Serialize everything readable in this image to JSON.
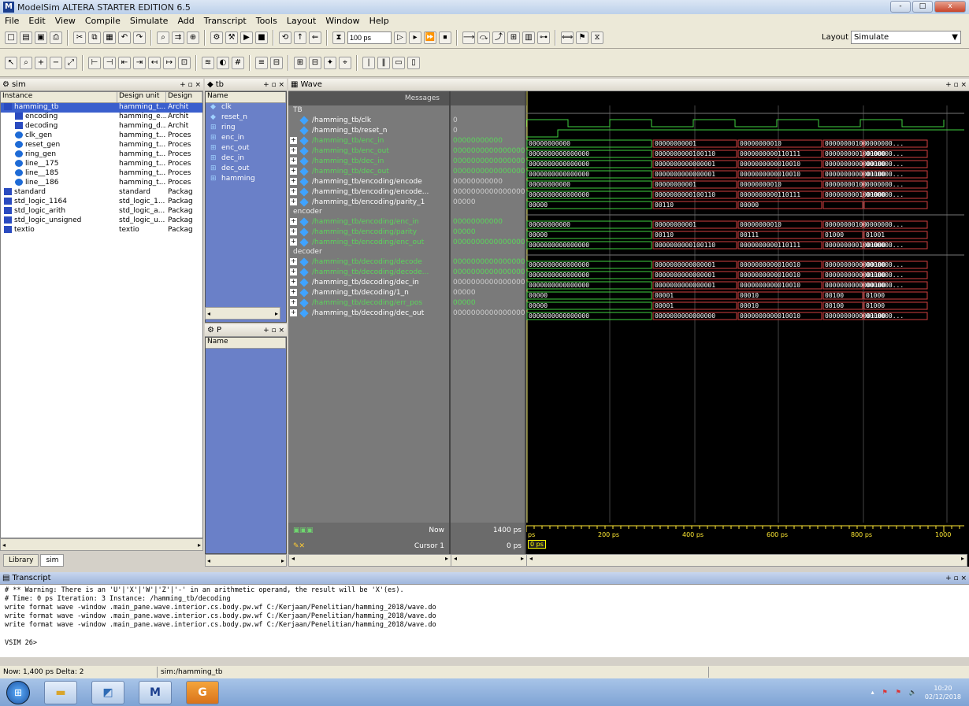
{
  "title": "ModelSim ALTERA STARTER EDITION 6.5",
  "window_controls": [
    "-",
    "□",
    "x"
  ],
  "menu": [
    "File",
    "Edit",
    "View",
    "Compile",
    "Simulate",
    "Add",
    "Transcript",
    "Tools",
    "Layout",
    "Window",
    "Help"
  ],
  "toolbar": {
    "sim_time": "100 ps",
    "layout_label": "Layout",
    "layout_value": "Simulate"
  },
  "sim_panel": {
    "title": "sim",
    "columns": [
      "Instance",
      "Design unit",
      "Design"
    ],
    "rows": [
      {
        "name": "hamming_tb",
        "unit": "hamming_t...",
        "type": "Archit",
        "icon": "box",
        "indent": 0,
        "selected": true
      },
      {
        "name": "encoding",
        "unit": "hamming_e...",
        "type": "Archit",
        "icon": "box",
        "indent": 1
      },
      {
        "name": "decoding",
        "unit": "hamming_d...",
        "type": "Archit",
        "icon": "box",
        "indent": 1
      },
      {
        "name": "clk_gen",
        "unit": "hamming_t...",
        "type": "Proces",
        "icon": "proc",
        "indent": 1
      },
      {
        "name": "reset_gen",
        "unit": "hamming_t...",
        "type": "Proces",
        "icon": "proc",
        "indent": 1
      },
      {
        "name": "ring_gen",
        "unit": "hamming_t...",
        "type": "Proces",
        "icon": "proc",
        "indent": 1
      },
      {
        "name": "line__175",
        "unit": "hamming_t...",
        "type": "Proces",
        "icon": "proc",
        "indent": 1
      },
      {
        "name": "line__185",
        "unit": "hamming_t...",
        "type": "Proces",
        "icon": "proc",
        "indent": 1
      },
      {
        "name": "line__186",
        "unit": "hamming_t...",
        "type": "Proces",
        "icon": "proc",
        "indent": 1
      },
      {
        "name": "standard",
        "unit": "standard",
        "type": "Packag",
        "icon": "box",
        "indent": 0
      },
      {
        "name": "std_logic_1164",
        "unit": "std_logic_1...",
        "type": "Packag",
        "icon": "box",
        "indent": 0
      },
      {
        "name": "std_logic_arith",
        "unit": "std_logic_a...",
        "type": "Packag",
        "icon": "box",
        "indent": 0
      },
      {
        "name": "std_logic_unsigned",
        "unit": "std_logic_u...",
        "type": "Packag",
        "icon": "box",
        "indent": 0
      },
      {
        "name": "textio",
        "unit": "textio",
        "type": "Packag",
        "icon": "box",
        "indent": 0
      }
    ],
    "tabs": [
      "Library",
      "sim"
    ]
  },
  "objects_panel": {
    "title": "tb",
    "column": "Name",
    "items": [
      "clk",
      "reset_n",
      "ring",
      "enc_in",
      "enc_out",
      "dec_in",
      "dec_out",
      "hamming"
    ]
  },
  "processes_panel": {
    "title": "P",
    "column": "Name"
  },
  "wave_panel": {
    "title": "Wave",
    "messages_label": "Messages",
    "groups": [
      {
        "label": "TB",
        "signals": [
          {
            "name": "/hamming_tb/clk",
            "value": "0",
            "green": false,
            "expand": false,
            "kind": "clk"
          },
          {
            "name": "/hamming_tb/reset_n",
            "value": "0",
            "green": false,
            "expand": false,
            "kind": "reset"
          },
          {
            "name": "/hamming_tb/enc_in",
            "value": "00000000000",
            "green": true,
            "expand": true,
            "kind": "bus",
            "segs": [
              "00000000000",
              "00000000001",
              "00000000010",
              "00000000100",
              "0000000..."
            ]
          },
          {
            "name": "/hamming_tb/enc_out",
            "value": "0000000000000000",
            "green": true,
            "expand": true,
            "kind": "bus",
            "segs": [
              "0000000000000000",
              "0000000000100110",
              "0000000000110111",
              "0000000001001000",
              "0000000..."
            ]
          },
          {
            "name": "/hamming_tb/dec_in",
            "value": "0000000000000000",
            "green": true,
            "expand": true,
            "kind": "bus",
            "segs": [
              "0000000000000000",
              "0000000000000001",
              "0000000000010010",
              "0000000000000100",
              "0000000..."
            ]
          },
          {
            "name": "/hamming_tb/dec_out",
            "value": "0000000000000000",
            "green": true,
            "expand": true,
            "kind": "bus",
            "segs": [
              "0000000000000000",
              "0000000000000001",
              "0000000000010010",
              "0000000000001100",
              "0000000..."
            ]
          },
          {
            "name": "/hamming_tb/encoding/encode",
            "value": "00000000000",
            "green": false,
            "expand": true,
            "kind": "bus",
            "segs": [
              "00000000000",
              "00000000001",
              "00000000010",
              "00000000100",
              "0000000..."
            ]
          },
          {
            "name": "/hamming_tb/encoding/encode...",
            "value": "0000000000000000",
            "green": false,
            "expand": true,
            "kind": "bus",
            "segs": [
              "0000000000000000",
              "0000000000100110",
              "0000000000110111",
              "0000000001001000",
              "0000000..."
            ]
          },
          {
            "name": "/hamming_tb/encoding/parity_1",
            "value": "00000",
            "green": false,
            "expand": true,
            "kind": "bus",
            "segs": [
              "00000",
              "00110",
              "00000",
              "",
              ""
            ]
          }
        ]
      },
      {
        "label": "encoder",
        "signals": [
          {
            "name": "/hamming_tb/encoding/enc_in",
            "value": "00000000000",
            "green": true,
            "expand": true,
            "kind": "bus",
            "segs": [
              "00000000000",
              "00000000001",
              "00000000010",
              "00000000100",
              "0000000..."
            ]
          },
          {
            "name": "/hamming_tb/encoding/parity",
            "value": "00000",
            "green": true,
            "expand": true,
            "kind": "bus",
            "segs": [
              "00000",
              "00110",
              "00111",
              "01000",
              "01001"
            ]
          },
          {
            "name": "/hamming_tb/encoding/enc_out",
            "value": "0000000000000000",
            "green": true,
            "expand": true,
            "kind": "bus",
            "segs": [
              "0000000000000000",
              "0000000000100110",
              "0000000000110111",
              "0000000001001000",
              "0000000..."
            ]
          }
        ]
      },
      {
        "label": "decoder",
        "signals": [
          {
            "name": "/hamming_tb/decoding/decode",
            "value": "0000000000000000",
            "green": true,
            "expand": true,
            "kind": "bus",
            "segs": [
              "0000000000000000",
              "0000000000000001",
              "0000000000010010",
              "0000000000000100",
              "0000000..."
            ]
          },
          {
            "name": "/hamming_tb/decoding/decode...",
            "value": "0000000000000000",
            "green": true,
            "expand": true,
            "kind": "bus",
            "segs": [
              "0000000000000000",
              "0000000000000001",
              "0000000000010010",
              "0000000000001100",
              "0000000..."
            ]
          },
          {
            "name": "/hamming_tb/decoding/dec_in",
            "value": "0000000000000000",
            "green": false,
            "expand": true,
            "kind": "bus",
            "segs": [
              "0000000000000000",
              "0000000000000001",
              "0000000000010010",
              "0000000000000100",
              "0000000..."
            ]
          },
          {
            "name": "/hamming_tb/decoding/1_n",
            "value": "00000",
            "green": false,
            "expand": true,
            "kind": "bus",
            "segs": [
              "00000",
              "00001",
              "00010",
              "00100",
              "01000"
            ]
          },
          {
            "name": "/hamming_tb/decoding/err_pos",
            "value": "00000",
            "green": true,
            "expand": true,
            "kind": "bus",
            "segs": [
              "00000",
              "00001",
              "00010",
              "00100",
              "01000"
            ]
          },
          {
            "name": "/hamming_tb/decoding/dec_out",
            "value": "0000000000000000",
            "green": false,
            "expand": true,
            "kind": "bus",
            "segs": [
              "0000000000000000",
              "0000000000000000",
              "0000000000010010",
              "0000000000001100",
              "0000000..."
            ]
          }
        ]
      }
    ],
    "now_label": "Now",
    "now_value": "1400 ps",
    "cursor_label": "Cursor 1",
    "cursor_value": "0 ps",
    "cursor_tag": "0 ps",
    "time_ticks": [
      "ps",
      "200 ps",
      "400 ps",
      "600 ps",
      "800 ps",
      "1000"
    ]
  },
  "transcript": {
    "title": "Transcript",
    "lines": [
      "# ** Warning: There is an 'U'|'X'|'W'|'Z'|'-' in an arithmetic operand, the result will be 'X'(es).",
      "#    Time: 0 ps  Iteration: 3  Instance: /hamming_tb/decoding",
      "write format wave -window .main_pane.wave.interior.cs.body.pw.wf C:/Kerjaan/Penelitian/hamming_2018/wave.do",
      "write format wave -window .main_pane.wave.interior.cs.body.pw.wf C:/Kerjaan/Penelitian/hamming_2018/wave.do",
      "write format wave -window .main_pane.wave.interior.cs.body.pw.wf C:/Kerjaan/Penelitian/hamming_2018/wave.do"
    ],
    "prompt": "VSIM 26>"
  },
  "status": {
    "now": "Now: 1,400 ps  Delta: 2",
    "path": "sim:/hamming_tb"
  },
  "taskbar": {
    "apps": [
      "start",
      "explorer",
      "paint",
      "modelsim",
      "quartus"
    ],
    "time": "10:20",
    "date": "02/12/2018"
  }
}
